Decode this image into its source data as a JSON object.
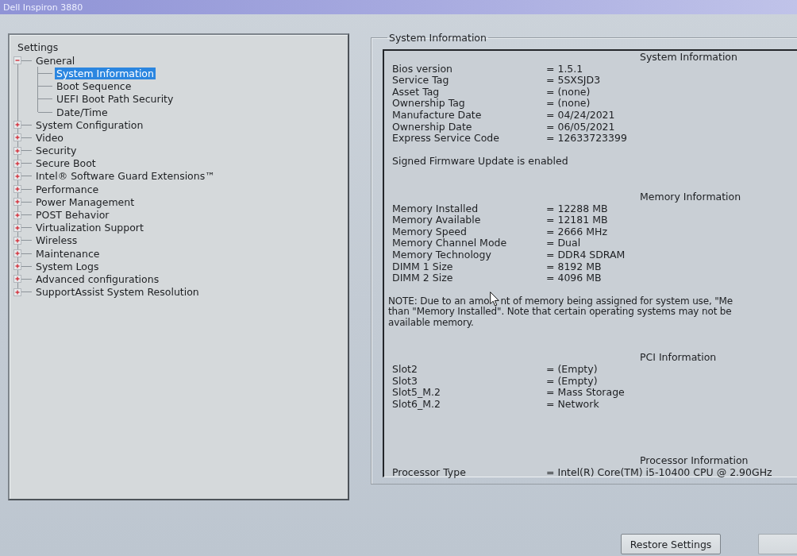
{
  "window": {
    "title": "Dell Inspiron 3880"
  },
  "settings_tree": {
    "title": "Settings",
    "items": [
      {
        "label": "General",
        "expanded": true,
        "selected": false,
        "children": [
          {
            "label": "System Information",
            "selected": true
          },
          {
            "label": "Boot Sequence",
            "selected": false
          },
          {
            "label": "UEFI Boot Path Security",
            "selected": false
          },
          {
            "label": "Date/Time",
            "selected": false
          }
        ]
      },
      {
        "label": "System Configuration",
        "expanded": false,
        "selected": false
      },
      {
        "label": "Video",
        "expanded": false,
        "selected": false
      },
      {
        "label": "Security",
        "expanded": false,
        "selected": false
      },
      {
        "label": "Secure Boot",
        "expanded": false,
        "selected": false
      },
      {
        "label": "Intel® Software Guard Extensions™",
        "expanded": false,
        "selected": false
      },
      {
        "label": "Performance",
        "expanded": false,
        "selected": false
      },
      {
        "label": "Power Management",
        "expanded": false,
        "selected": false
      },
      {
        "label": "POST Behavior",
        "expanded": false,
        "selected": false
      },
      {
        "label": "Virtualization Support",
        "expanded": false,
        "selected": false
      },
      {
        "label": "Wireless",
        "expanded": false,
        "selected": false
      },
      {
        "label": "Maintenance",
        "expanded": false,
        "selected": false
      },
      {
        "label": "System Logs",
        "expanded": false,
        "selected": false
      },
      {
        "label": "Advanced configurations",
        "expanded": false,
        "selected": false
      },
      {
        "label": "SupportAssist System Resolution",
        "expanded": false,
        "selected": false
      }
    ]
  },
  "system_information": {
    "title": "System Information",
    "sections": [
      {
        "heading": "System Information",
        "rows": [
          {
            "label": "Bios version",
            "value": "= 1.5.1"
          },
          {
            "label": "Service Tag",
            "value": "= 5SXSJD3"
          },
          {
            "label": "Asset Tag",
            "value": "= (none)"
          },
          {
            "label": "Ownership Tag",
            "value": "= (none)"
          },
          {
            "label": "Manufacture Date",
            "value": "= 04/24/2021"
          },
          {
            "label": "Ownership Date",
            "value": "= 06/05/2021"
          },
          {
            "label": "Express Service Code",
            "value": "= 12633723399"
          }
        ],
        "status": "Signed Firmware Update is enabled"
      },
      {
        "heading": "Memory Information",
        "rows": [
          {
            "label": "Memory Installed",
            "value": "= 12288 MB"
          },
          {
            "label": "Memory Available",
            "value": "= 12181 MB"
          },
          {
            "label": "Memory Speed",
            "value": "= 2666 MHz"
          },
          {
            "label": "Memory Channel Mode",
            "value": "= Dual"
          },
          {
            "label": "Memory Technology",
            "value": "= DDR4 SDRAM"
          },
          {
            "label": "DIMM 1 Size",
            "value": "= 8192 MB"
          },
          {
            "label": "DIMM 2 Size",
            "value": "= 4096 MB"
          }
        ],
        "note_lines": [
          {
            "parts": [
              "NOTE: Due to an amo",
              "nt of memory being assigned for system use, \"Me"
            ]
          },
          {
            "parts": [
              "than \"Memory Installed\". Note that certain operating systems may not be"
            ]
          },
          {
            "parts": [
              "available memory."
            ]
          }
        ]
      },
      {
        "heading": "PCI Information",
        "rows": [
          {
            "label": "Slot2",
            "value": "= (Empty)"
          },
          {
            "label": "Slot3",
            "value": "= (Empty)"
          },
          {
            "label": "Slot5_M.2",
            "value": "= Mass Storage"
          },
          {
            "label": "Slot6_M.2",
            "value": "= Network"
          }
        ]
      },
      {
        "heading": "Processor Information",
        "rows": [
          {
            "label": "Processor Type",
            "value": "= Intel(R) Core(TM) i5-10400 CPU @ 2.90GHz"
          }
        ]
      }
    ]
  },
  "buttons": [
    {
      "label": "Restore Settings"
    }
  ]
}
